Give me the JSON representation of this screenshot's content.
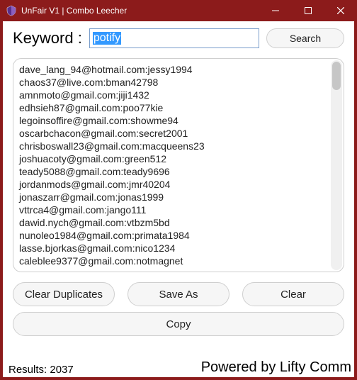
{
  "window": {
    "title": "UnFair V1 | Combo Leecher",
    "minimize": "–",
    "maximize": "▢",
    "close": "✕"
  },
  "search": {
    "label": "Keyword :",
    "value": "potify",
    "button": "Search"
  },
  "results": [
    "dave_lang_94@hotmail.com:jessy1994",
    "chaos37@live.com:bman42798",
    "amnmoto@gmail.com:jiji1432",
    "edhsieh87@gmail.com:poo77kie",
    "legoinsoffire@gmail.com:showme94",
    "oscarbchacon@gmail.com:secret2001",
    "chrisboswall23@gmail.com:macqueens23",
    "joshuacoty@gmail.com:green512",
    "teady5088@gmail.com:teady9696",
    "jordanmods@gmail.com:jmr40204",
    "jonaszarr@gmail.com:jonas1999",
    "vttrca4@gmail.com:jango111",
    "dawid.nych@gmail.com:vtbzm5bd",
    "nunoleo1984@gmail.com:primata1984",
    "lasse.bjorkas@gmail.com:nico1234",
    "caleblee9377@gmail.com:notmagnet"
  ],
  "buttons": {
    "clearDuplicates": "Clear Duplicates",
    "saveAs": "Save As",
    "clear": "Clear",
    "copy": "Copy"
  },
  "status": {
    "results_label": "Results: ",
    "results_count": "2037",
    "powered": "Powered by Lifty Comm"
  }
}
